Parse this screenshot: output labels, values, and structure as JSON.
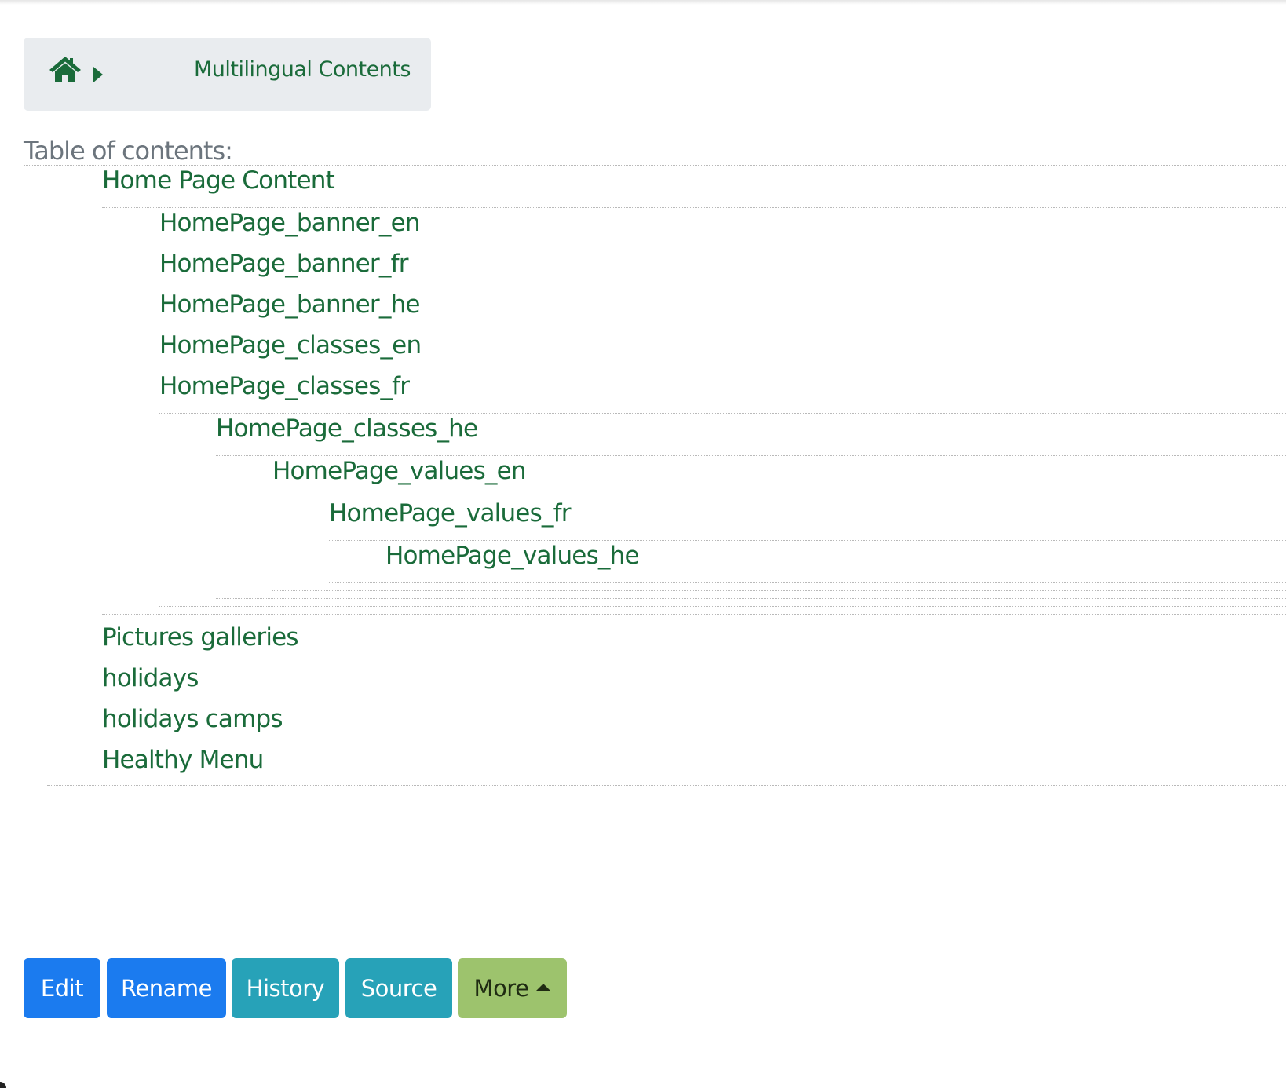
{
  "breadcrumb": {
    "home_icon": "home-icon",
    "separator_icon": "caret-right-icon",
    "current": "Multilingual Contents"
  },
  "toc": {
    "label": "Table of contents:",
    "items": [
      "Home Page Content",
      "HomePage_banner_en",
      "HomePage_banner_fr",
      "HomePage_banner_he",
      "HomePage_classes_en",
      "HomePage_classes_fr",
      "HomePage_classes_he",
      "HomePage_values_en",
      "HomePage_values_fr",
      "HomePage_values_he",
      "Pictures galleries",
      "holidays",
      "holidays camps",
      "Healthy Menu"
    ]
  },
  "actions": {
    "edit": "Edit",
    "rename": "Rename",
    "history": "History",
    "source": "Source",
    "more": "More"
  },
  "colors": {
    "link": "#1a6b3a",
    "primary": "#1b7bef",
    "info": "#27a2b8",
    "more": "#9dc36d",
    "breadcrumb_bg": "#e9ecef"
  }
}
